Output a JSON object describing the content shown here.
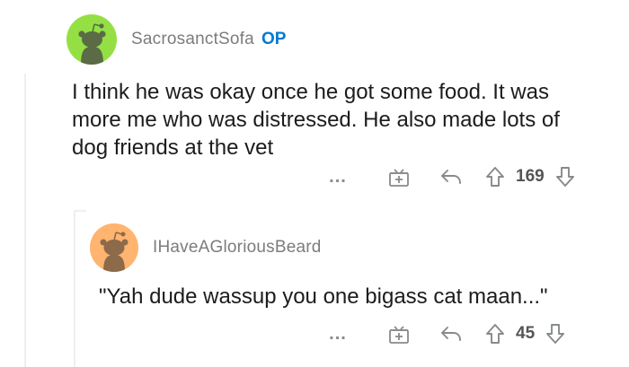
{
  "comments": [
    {
      "username": "SacrosanctSofa",
      "badge": "OP",
      "avatar_color": "#94e044",
      "body_lines": [
        "I think he was okay once he got some food. It was",
        "more me who was distressed. He also made lots of",
        "dog friends at the vet"
      ],
      "more_label": "...",
      "score": "169"
    },
    {
      "username": "IHaveAGloriousBeard",
      "avatar_color": "#ffb470",
      "body_lines": [
        "\"Yah dude wassup you one bigass cat maan...\""
      ],
      "more_label": "...",
      "score": "45"
    }
  ],
  "icons": {
    "more": "more-options-icon",
    "award": "award-gift-icon",
    "reply": "reply-arrow-icon",
    "upvote": "upvote-arrow-icon",
    "downvote": "downvote-arrow-icon"
  },
  "colors": {
    "username": "#7c7c7c",
    "op_badge": "#0079d3",
    "icon": "#878a8c",
    "thread_line": "#edeff1"
  }
}
